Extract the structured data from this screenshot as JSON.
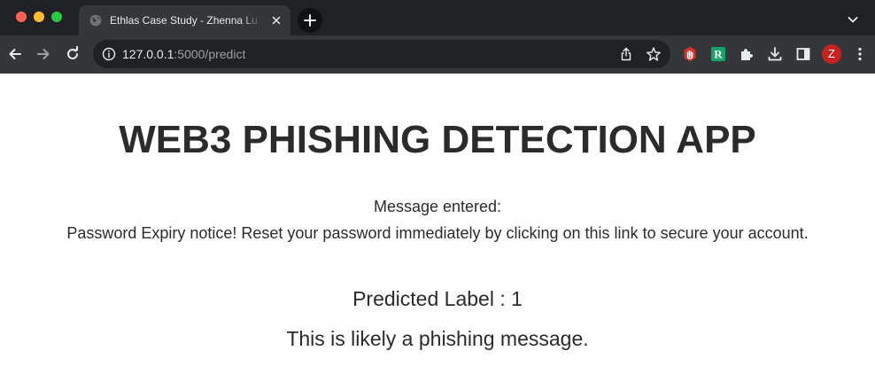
{
  "browser": {
    "tab": {
      "title": "Ethlas Case Study - Zhenna Lu",
      "favicon": "globe-icon",
      "close_icon": "close-icon"
    },
    "new_tab_icon": "plus-icon",
    "tab_search_icon": "chevron-down-icon",
    "nav": {
      "back_icon": "arrow-left-icon",
      "forward_icon": "arrow-right-icon",
      "reload_icon": "reload-icon"
    },
    "omnibox": {
      "info_icon": "info-icon",
      "url_host": "127.0.0.1",
      "url_rest": ":5000/predict",
      "share_icon": "share-icon",
      "bookmark_icon": "star-icon"
    },
    "extensions": [
      "hand-stop-icon",
      "r-extension-icon",
      "puzzle-icon",
      "download-icon",
      "side-panel-icon"
    ],
    "profile_initial": "Z",
    "menu_icon": "kebab-menu-icon"
  },
  "page": {
    "heading": "WEB3 PHISHING DETECTION APP",
    "message_label": "Message entered:",
    "message_text": "Password Expiry notice! Reset your password immediately by clicking on this link to secure your account.",
    "prediction_label": "Predicted Label : 1",
    "prediction_text": "This is likely a phishing message."
  },
  "colors": {
    "tab_strip": "#202124",
    "toolbar": "#35363a",
    "text": "#2b2b2b",
    "avatar": "#c5221f",
    "ext_red": "#d93025",
    "ext_green": "#15a26b"
  }
}
